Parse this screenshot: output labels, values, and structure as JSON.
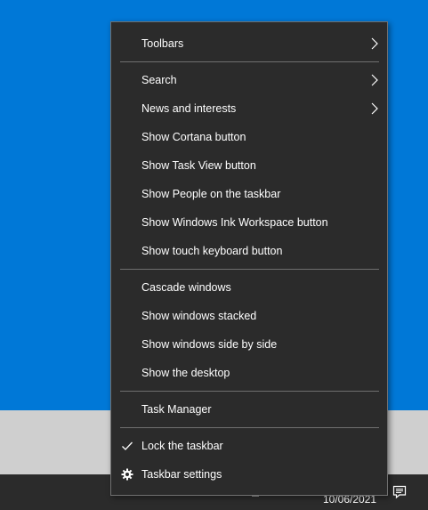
{
  "context_menu": {
    "items": [
      {
        "label": "Toolbars",
        "submenu": true
      },
      {
        "label": "Search",
        "submenu": true
      },
      {
        "label": "News and interests",
        "submenu": true
      },
      {
        "label": "Show Cortana button"
      },
      {
        "label": "Show Task View button"
      },
      {
        "label": "Show People on the taskbar"
      },
      {
        "label": "Show Windows Ink Workspace button"
      },
      {
        "label": "Show touch keyboard button"
      },
      {
        "label": "Cascade windows"
      },
      {
        "label": "Show windows stacked"
      },
      {
        "label": "Show windows side by side"
      },
      {
        "label": "Show the desktop"
      },
      {
        "label": "Task Manager"
      },
      {
        "label": "Lock the taskbar",
        "checked": true,
        "icon": "checkmark-icon"
      },
      {
        "label": "Taskbar settings",
        "icon": "gear-icon"
      }
    ]
  },
  "taskbar": {
    "date": "10/06/2021",
    "notification_icon": "action-center-icon"
  },
  "colors": {
    "desktop": "#0078d7",
    "menu_background": "#2b2b2b",
    "menu_text": "#ffffff",
    "separator": "#6f6f6f"
  }
}
